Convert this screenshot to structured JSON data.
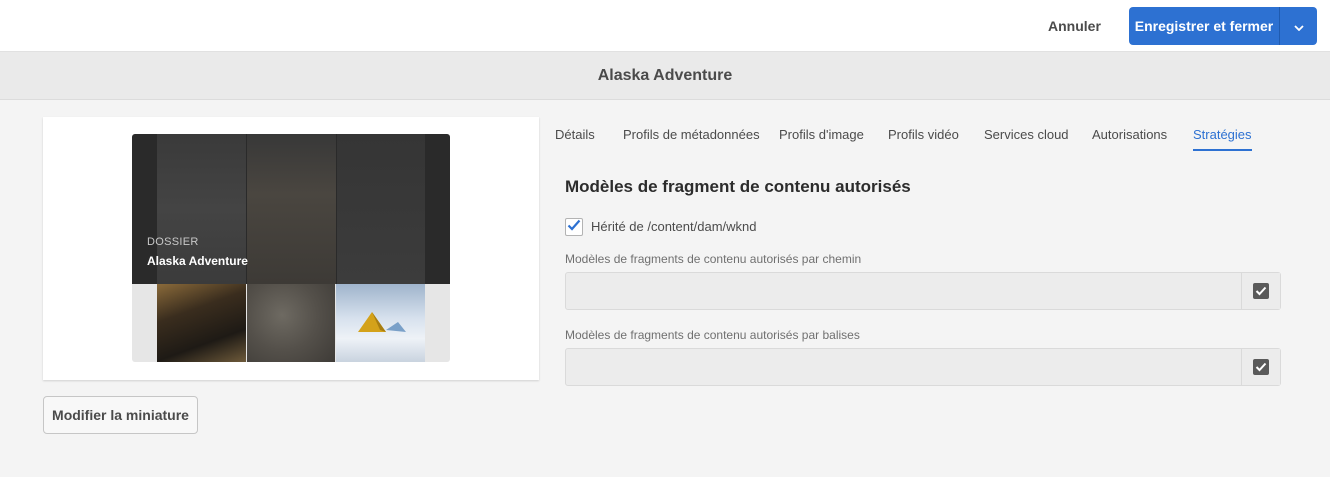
{
  "toolbar": {
    "cancel_label": "Annuler",
    "save_label": "Enregistrer et fermer",
    "accent": "#2d71d2"
  },
  "header": {
    "title": "Alaska Adventure"
  },
  "thumbnail": {
    "type_label": "DOSSIER",
    "name": "Alaska Adventure",
    "edit_label": "Modifier la miniature"
  },
  "tabs": [
    {
      "label": "Détails"
    },
    {
      "label": "Profils de métadonnées"
    },
    {
      "label": "Profils d'image"
    },
    {
      "label": "Profils vidéo"
    },
    {
      "label": "Services cloud"
    },
    {
      "label": "Autorisations"
    },
    {
      "label": "Stratégies",
      "active": true
    }
  ],
  "policies": {
    "section_title": "Modèles de fragment de contenu autorisés",
    "inherit_checked": true,
    "inherit_label": "Hérité de /content/dam/wknd",
    "by_path_label": "Modèles de fragments de contenu autorisés par chemin",
    "by_path_value": "",
    "by_tags_label": "Modèles de fragments de contenu autorisés par balises",
    "by_tags_value": ""
  },
  "icons": {
    "dropdown": "chevron-down-icon",
    "checkbox": "checkmark-icon",
    "picker": "picker-icon"
  }
}
